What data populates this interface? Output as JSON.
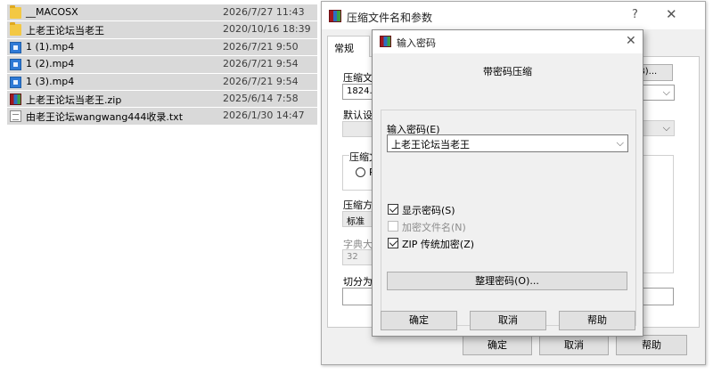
{
  "files": [
    {
      "name": "__MACOSX",
      "date": "2026/7/27 11:43",
      "icon": "folder-icon"
    },
    {
      "name": "上老王论坛当老王",
      "date": "2020/10/16 18:39",
      "icon": "folder-icon"
    },
    {
      "name": "1 (1).mp4",
      "date": "2026/7/21 9:50",
      "icon": "media-file-icon"
    },
    {
      "name": "1 (2).mp4",
      "date": "2026/7/21 9:54",
      "icon": "media-file-icon"
    },
    {
      "name": "1 (3).mp4",
      "date": "2026/7/21 9:54",
      "icon": "media-file-icon"
    },
    {
      "name": "上老王论坛当老王.zip",
      "date": "2025/6/14 7:58",
      "icon": "winrar-archive-icon"
    },
    {
      "name": "由老王论坛wangwang444收录.txt",
      "date": "2026/1/30 14:47",
      "icon": "text-file-icon"
    }
  ],
  "main_dialog": {
    "title": "压缩文件名和参数",
    "help_glyph": "?",
    "close_glyph": "✕",
    "tab_general": "常规",
    "archive_name_label": "压缩文",
    "archive_name_value": "1824.z",
    "browse_label": "(B)...",
    "default_label": "默认设",
    "format_group_label": "压缩文",
    "format_radio_label": "R",
    "method_label": "压缩方",
    "method_value": "标准",
    "dict_label": "字典大",
    "dict_value": "32",
    "split_label": "切分为",
    "ok": "确定",
    "cancel": "取消",
    "help": "帮助"
  },
  "password_dialog": {
    "title": "输入密码",
    "close_glyph": "✕",
    "heading": "带密码压缩",
    "password_label": "输入密码(E)",
    "password_value": "上老王论坛当老王",
    "show_password": "显示密码(S)",
    "encrypt_filenames": "加密文件名(N)",
    "zip_legacy": "ZIP 传统加密(Z)",
    "organize_passwords": "整理密码(O)...",
    "ok": "确定",
    "cancel": "取消",
    "help": "帮助"
  },
  "colors": {
    "selection_gray": "#d9d9d9",
    "dialog_bg": "#f0f0f0",
    "button_bg": "#e1e1e1"
  }
}
